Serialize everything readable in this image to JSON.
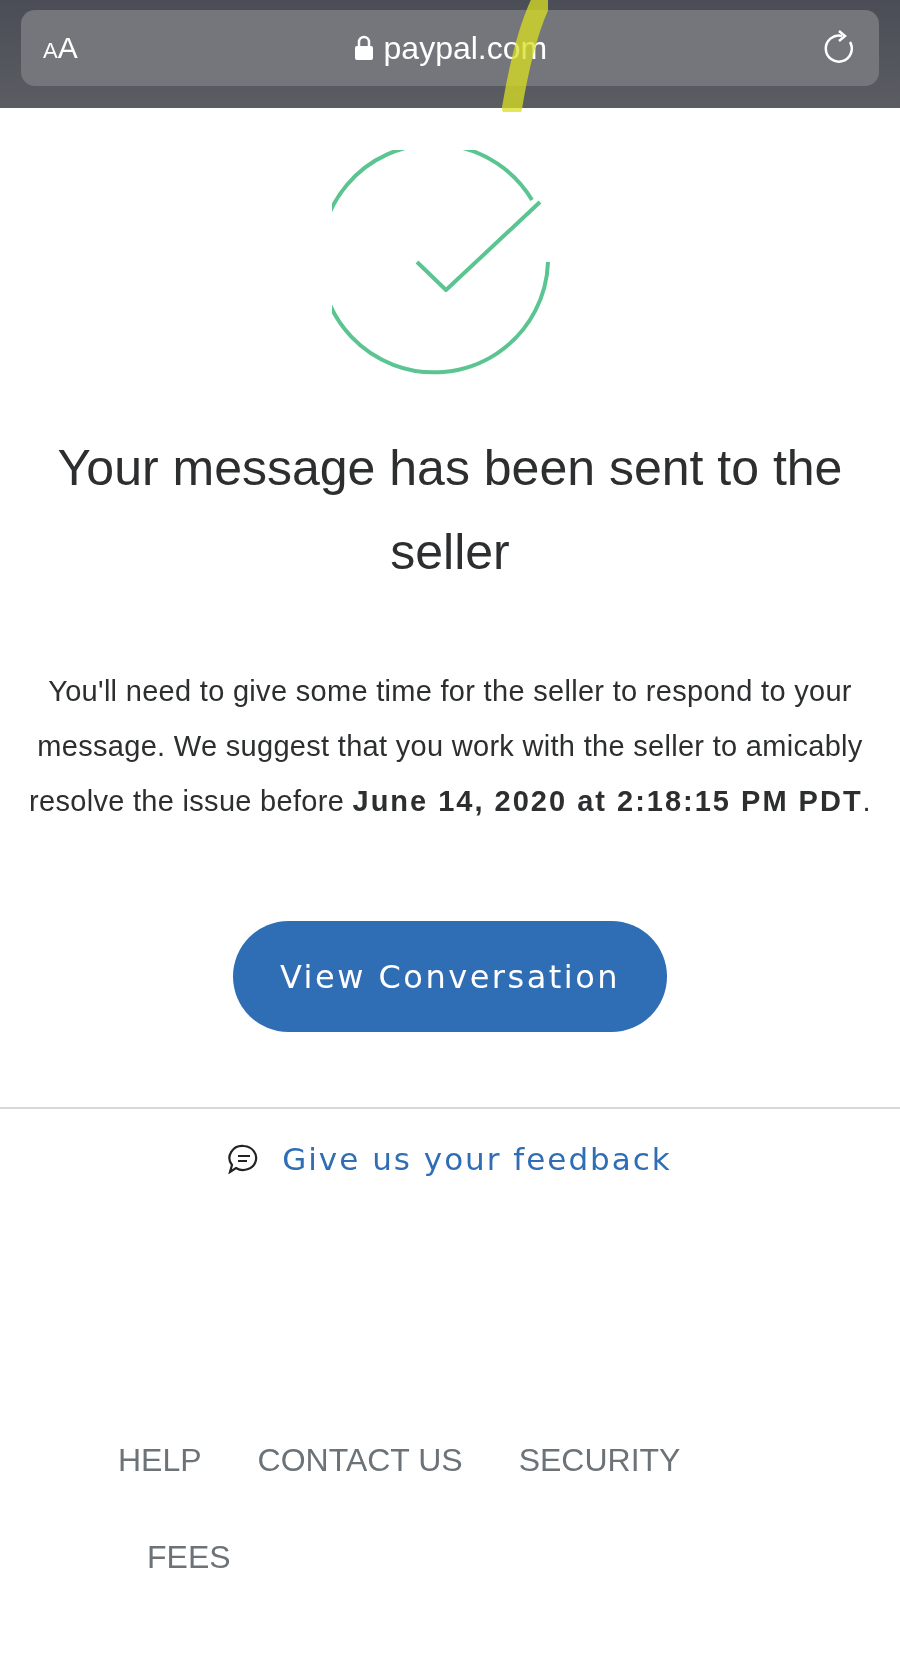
{
  "browser_bar": {
    "text_size_button": "AA",
    "url": "paypal.com"
  },
  "confirmation": {
    "title": "Your message has been sent to the seller",
    "message": "You'll need to give some time for the seller to respond to your message. We suggest that you work with the seller to amicably resolve the issue before **June 14, 2020 at 2:18:15 PM PDT**."
  },
  "primary_button": "View Conversation",
  "feedback_link": "Give us your feedback",
  "footer_links": [
    "HELP",
    "CONTACT US",
    "SECURITY",
    "FEES"
  ]
}
